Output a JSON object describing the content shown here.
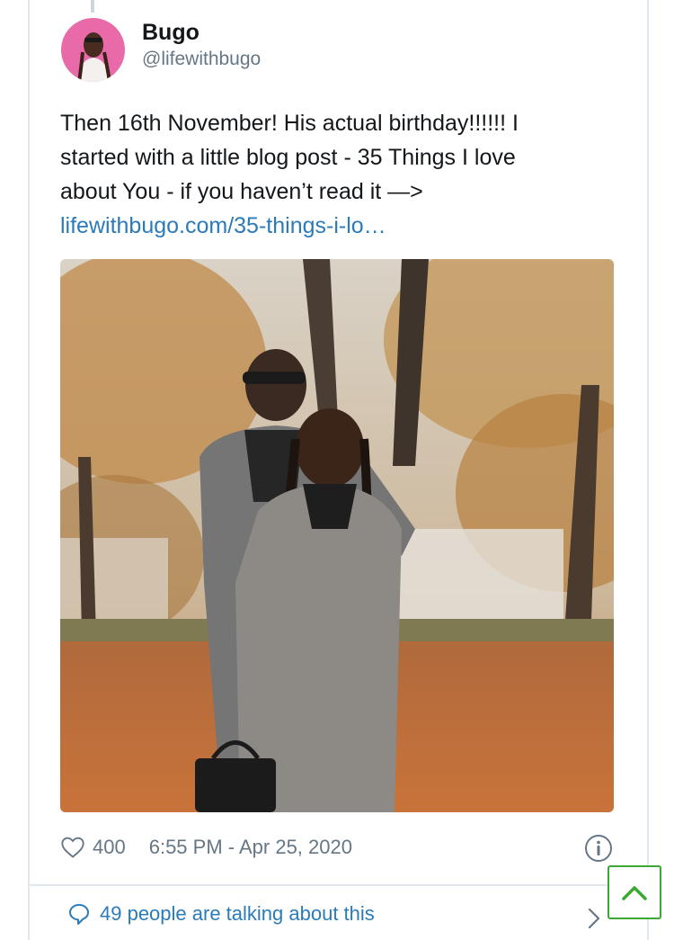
{
  "author": {
    "name": "Bugo",
    "handle": "@lifewithbugo",
    "avatar_icon": "profile-photo"
  },
  "tweet": {
    "text_lines": [
      "Then 16th November! His actual birthday!!!!!! I",
      "started with a little blog post - 35 Things I love",
      "about You - if you haven’t read it —>"
    ],
    "link_text": "lifewithbugo.com/35-things-i-lo…",
    "photo_icon": "couple-in-autumn-park-photo"
  },
  "meta": {
    "like_icon": "heart-icon",
    "likes": "400",
    "timestamp": "6:55 PM - Apr 25, 2020",
    "info_icon": "info-icon"
  },
  "conversation": {
    "icon": "speech-bubble-icon",
    "label": "49 people are talking about this",
    "chevron_icon": "chevron-right-icon"
  },
  "scroll_top": {
    "icon": "chevron-up-icon"
  },
  "colors": {
    "link": "#2b7bb9",
    "muted": "#657786",
    "border": "#e1e8ed",
    "scroll_button_border": "#3aa832"
  }
}
